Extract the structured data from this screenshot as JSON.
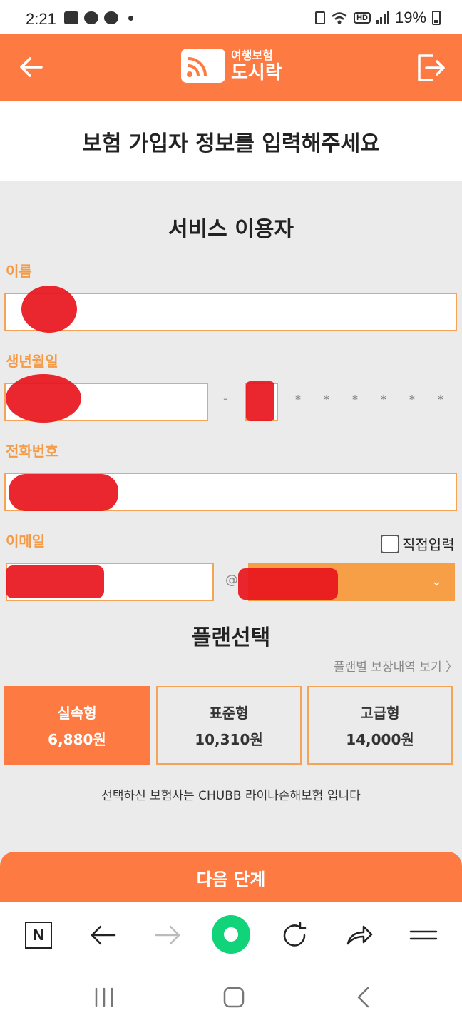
{
  "status_bar": {
    "time": "2:21",
    "battery": "19%",
    "network": "HD"
  },
  "app_bar": {
    "logo_line1": "여행보험",
    "logo_line2": "도시락"
  },
  "page_title": "보험 가입자 정보를 입력해주세요",
  "service_user": {
    "section_title": "서비스 이용자",
    "name_label": "이름",
    "birth_label": "생년월일",
    "birth_masked": [
      "*",
      "*",
      "*",
      "*",
      "*",
      "*"
    ],
    "phone_label": "전화번호",
    "email_label": "이메일",
    "direct_input_label": "직접입력",
    "at_sign": "@"
  },
  "plan": {
    "section_title": "플랜선택",
    "detail_link": "플랜별 보장내역 보기 〉",
    "options": [
      {
        "name": "실속형",
        "price": "6,880원",
        "selected": true
      },
      {
        "name": "표준형",
        "price": "10,310원",
        "selected": false
      },
      {
        "name": "고급형",
        "price": "14,000원",
        "selected": false
      }
    ],
    "insurer_note": "선택하신 보험사는 CHUBB 라이나손해보험 입니다"
  },
  "next_button": "다음 단계",
  "colors": {
    "brand": "#fd7b43",
    "label": "#f59b47",
    "field_border": "#f5a457",
    "form_bg": "#ebebeb",
    "naver_green": "#11d37a"
  }
}
